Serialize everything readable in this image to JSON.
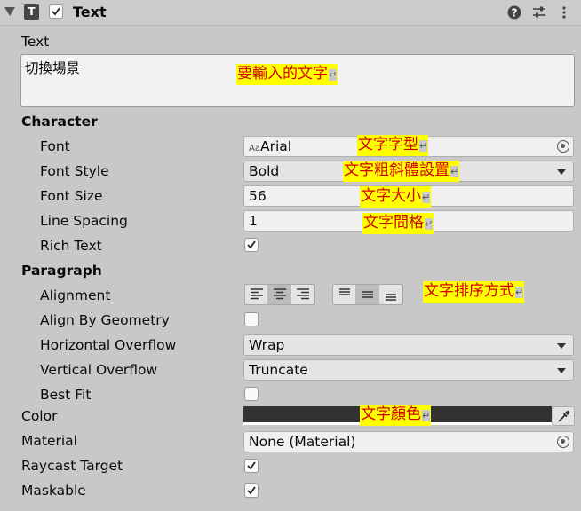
{
  "header": {
    "title": "Text",
    "component_enabled": true,
    "icons": [
      "fold-arrow-icon",
      "text-component-icon",
      "help-icon",
      "preset-icon",
      "kebab-menu-icon"
    ]
  },
  "text_field": {
    "label": "Text",
    "value": "切換場景",
    "note": "要輸入的文字"
  },
  "character": {
    "heading": "Character",
    "font": {
      "label": "Font",
      "prefix": "Aa",
      "value": "Arial",
      "note": "文字字型"
    },
    "font_style": {
      "label": "Font Style",
      "value": "Bold",
      "note": "文字粗斜體設置"
    },
    "font_size": {
      "label": "Font Size",
      "value": "56",
      "note": "文字大小"
    },
    "line_spacing": {
      "label": "Line Spacing",
      "value": "1",
      "note": "文字間格"
    },
    "rich_text": {
      "label": "Rich Text",
      "checked": true
    }
  },
  "paragraph": {
    "heading": "Paragraph",
    "alignment": {
      "label": "Alignment",
      "note": "文字排序方式",
      "horizontal_selected": "center",
      "vertical_selected": "middle"
    },
    "align_by_geometry": {
      "label": "Align By Geometry",
      "checked": false
    },
    "horizontal_overflow": {
      "label": "Horizontal Overflow",
      "value": "Wrap"
    },
    "vertical_overflow": {
      "label": "Vertical Overflow",
      "value": "Truncate"
    },
    "best_fit": {
      "label": "Best Fit",
      "checked": false
    }
  },
  "color": {
    "label": "Color",
    "value": "#323232",
    "note": "文字顏色"
  },
  "material": {
    "label": "Material",
    "value": "None (Material)"
  },
  "raycast_target": {
    "label": "Raycast Target",
    "checked": true
  },
  "maskable": {
    "label": "Maskable",
    "checked": true
  },
  "return_mark": "↵",
  "colors": {
    "annotation_bg": "#ffff00",
    "annotation_text": "#d40000",
    "panel_bg": "#c8c8c8"
  }
}
